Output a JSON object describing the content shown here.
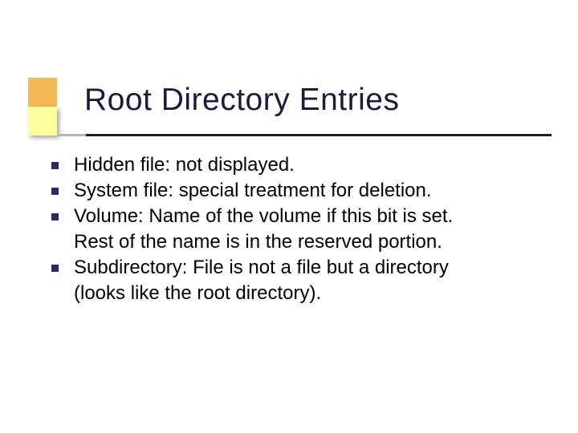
{
  "title": "Root Directory Entries",
  "lines": [
    {
      "bullet": true,
      "text": "Hidden file: not displayed."
    },
    {
      "bullet": true,
      "text": "System file: special treatment for deletion."
    },
    {
      "bullet": true,
      "text": "Volume: Name of the volume if this bit is set."
    },
    {
      "bullet": false,
      "text": "Rest of the name is in the reserved portion."
    },
    {
      "bullet": true,
      "text": "Subdirectory: File is not a file but a directory"
    },
    {
      "bullet": false,
      "text": "(looks like the root directory)."
    }
  ]
}
